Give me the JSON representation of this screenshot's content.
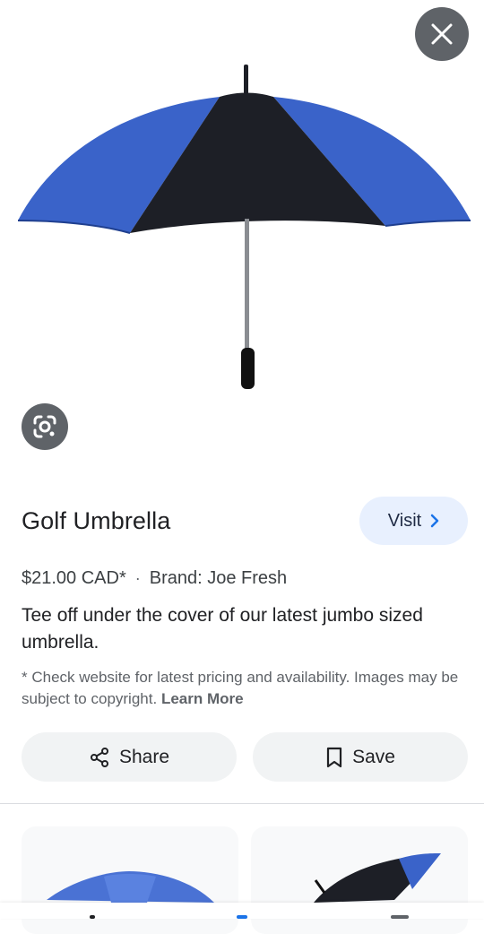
{
  "product": {
    "title": "Golf Umbrella",
    "price": "$21.00 CAD*",
    "separator": "·",
    "brand": "Brand: Joe Fresh",
    "description": "Tee off under the cover of our latest jumbo sized umbrella.",
    "disclaimer": "* Check website for latest pricing and availability. Images may be subject to copyright.",
    "learn_more": "Learn More"
  },
  "actions": {
    "visit_label": "Visit",
    "share_label": "Share",
    "save_label": "Save"
  },
  "icons": {
    "close": "close-icon",
    "lens": "google-lens-icon",
    "share": "share-icon",
    "save": "bookmark-icon",
    "visit_chevron": "chevron-right-icon"
  },
  "colors": {
    "umbrella_blue": "#3a63c9",
    "umbrella_black": "#1d1f26",
    "visit_bg": "#e8f0fe",
    "visit_chevron": "#1a73e8",
    "button_bg": "#f1f3f4"
  }
}
